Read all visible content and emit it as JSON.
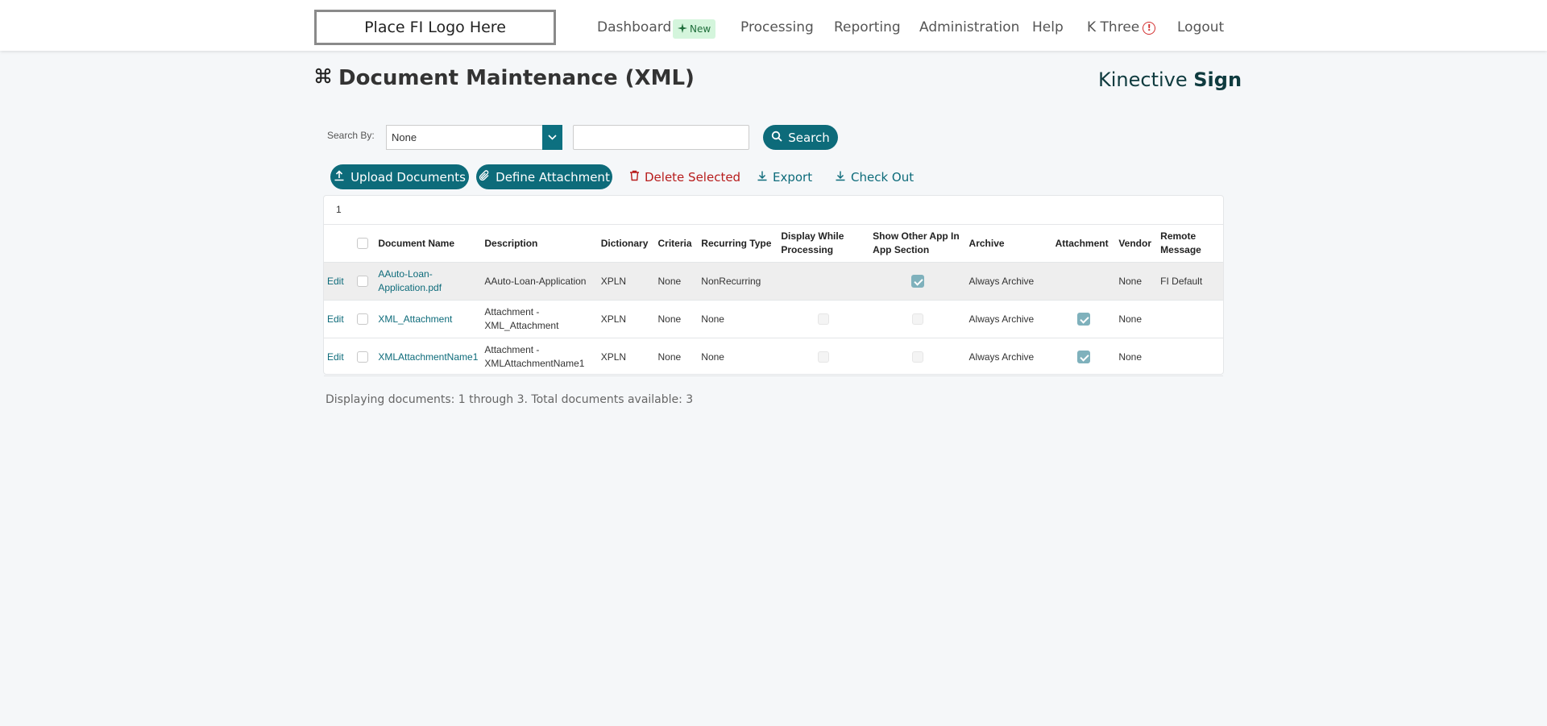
{
  "header": {
    "logo_text": "Place FI Logo Here",
    "nav": {
      "dashboard": "Dashboard",
      "new_badge": "New",
      "processing": "Processing",
      "reporting": "Reporting",
      "administration": "Administration",
      "help": "Help",
      "user": "K Three",
      "alert_symbol": "!",
      "logout": "Logout"
    }
  },
  "page": {
    "title": "Document Maintenance (XML)",
    "brand_light": "Kinective",
    "brand_bold": "Sign"
  },
  "search": {
    "label": "Search By:",
    "selected": "None",
    "input_value": "",
    "button": "Search"
  },
  "toolbar": {
    "upload": "Upload Documents",
    "define": "Define Attachment",
    "delete": "Delete Selected",
    "export": "Export",
    "checkout": "Check Out"
  },
  "table": {
    "count_label": "1",
    "headers": {
      "document_name": "Document Name",
      "description": "Description",
      "dictionary": "Dictionary",
      "criteria": "Criteria",
      "recurring_type": "Recurring Type",
      "display_while_processing": "Display While Processing",
      "show_other_app": "Show Other App In App Section",
      "archive": "Archive",
      "attachment": "Attachment",
      "vendor": "Vendor",
      "remote_message": "Remote Message"
    },
    "edit_label": "Edit",
    "rows": [
      {
        "name": "AAuto-Loan-Application.pdf",
        "description": "AAuto-Loan-Application",
        "dictionary": "XPLN",
        "criteria": "None",
        "recurring_type": "NonRecurring",
        "display_while_processing": null,
        "show_other_app": true,
        "archive": "Always Archive",
        "attachment": null,
        "vendor": "None",
        "remote_message": "FI Default"
      },
      {
        "name": "XML_Attachment",
        "description": "Attachment - XML_Attachment",
        "dictionary": "XPLN",
        "criteria": "None",
        "recurring_type": "None",
        "display_while_processing": false,
        "show_other_app": false,
        "archive": "Always Archive",
        "attachment": true,
        "vendor": "None",
        "remote_message": ""
      },
      {
        "name": "XMLAttachmentName1",
        "description": "Attachment - XMLAttachmentName1",
        "dictionary": "XPLN",
        "criteria": "None",
        "recurring_type": "None",
        "display_while_processing": false,
        "show_other_app": false,
        "archive": "Always Archive",
        "attachment": true,
        "vendor": "None",
        "remote_message": ""
      }
    ]
  },
  "footer": {
    "summary": "Displaying documents: 1 through 3. Total documents available: 3"
  },
  "colors": {
    "accent": "#0d6b7a",
    "delete": "#b71c1c",
    "alert": "#d32f2f",
    "badge_bg": "#d4f5dc"
  }
}
